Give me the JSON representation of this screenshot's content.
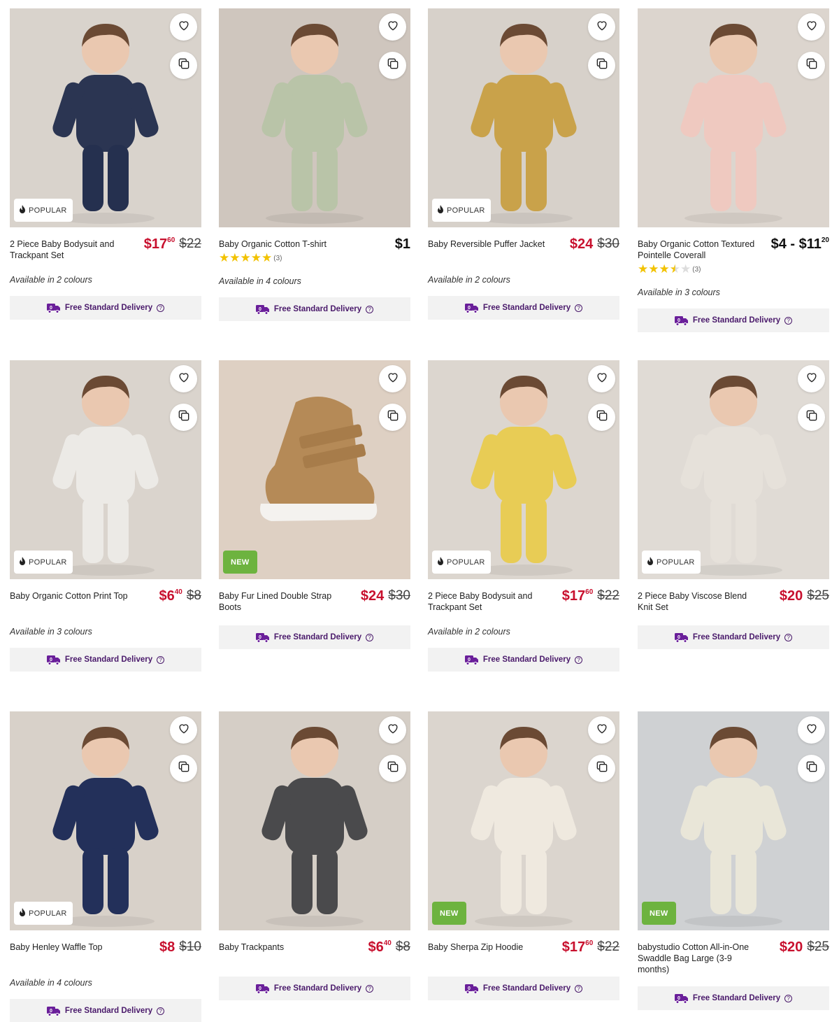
{
  "products": [
    {
      "name": "2 Piece Baby Bodysuit and Trackpant Set",
      "price_main": "$17",
      "price_cents": "60",
      "was": "$22",
      "availability": "Available in 2 colours",
      "badge": "POPULAR",
      "delivery": "Free Standard Delivery",
      "bg": "#d9d3cc"
    },
    {
      "name": "Baby Organic Cotton T-shirt",
      "price_main": "$1",
      "price_cents": "",
      "was": "",
      "rating": 5,
      "rating_count": "(3)",
      "availability": "Available in 4 colours",
      "badge": "",
      "delivery": "Free Standard Delivery",
      "bg": "#cfc6be"
    },
    {
      "name": "Baby Reversible Puffer Jacket",
      "price_main": "$24",
      "price_cents": "",
      "was": "$30",
      "availability": "Available in 2 colours",
      "badge": "POPULAR",
      "delivery": "Free Standard Delivery",
      "bg": "#d7d1ca"
    },
    {
      "name": "Baby Organic Cotton Textured Pointelle Coverall",
      "price_main": "$4 - $11",
      "price_cents": "20",
      "was": "",
      "rating": 3.5,
      "rating_count": "(3)",
      "availability": "Available in 3 colours",
      "badge": "",
      "delivery": "Free Standard Delivery",
      "bg": "#dcd5ce"
    },
    {
      "name": "Baby Organic Cotton Print Top",
      "price_main": "$6",
      "price_cents": "40",
      "was": "$8",
      "availability": "Available in 3 colours",
      "badge": "POPULAR",
      "delivery": "Free Standard Delivery",
      "bg": "#dad4cd"
    },
    {
      "name": "Baby Fur Lined Double Strap Boots",
      "price_main": "$24",
      "price_cents": "",
      "was": "$30",
      "availability": "",
      "badge": "NEW",
      "delivery": "Free Standard Delivery",
      "bg": "#ded0c3"
    },
    {
      "name": "2 Piece Baby Bodysuit and Trackpant Set",
      "price_main": "$17",
      "price_cents": "60",
      "was": "$22",
      "availability": "Available in 2 colours",
      "badge": "POPULAR",
      "delivery": "Free Standard Delivery",
      "bg": "#dcd6cf"
    },
    {
      "name": "2 Piece Baby Viscose Blend Knit Set",
      "price_main": "$20",
      "price_cents": "",
      "was": "$25",
      "availability": "",
      "badge": "POPULAR",
      "delivery": "Free Standard Delivery",
      "bg": "#e0dbd5"
    },
    {
      "name": "Baby Henley Waffle Top",
      "price_main": "$8",
      "price_cents": "",
      "was": "$10",
      "availability": "Available in 4 colours",
      "badge": "POPULAR",
      "delivery": "Free Standard Delivery",
      "bg": "#d8d1c9"
    },
    {
      "name": "Baby Trackpants",
      "price_main": "$6",
      "price_cents": "40",
      "was": "$8",
      "availability": "",
      "badge": "",
      "delivery": "Free Standard Delivery",
      "bg": "#d5cec6"
    },
    {
      "name": "Baby Sherpa Zip Hoodie",
      "price_main": "$17",
      "price_cents": "60",
      "was": "$22",
      "availability": "",
      "badge": "NEW",
      "delivery": "Free Standard Delivery",
      "bg": "#dbd5ce"
    },
    {
      "name": "babystudio Cotton All-in-One Swaddle Bag Large (3-9 months)",
      "price_main": "$20",
      "price_cents": "",
      "was": "$25",
      "availability": "",
      "badge": "NEW",
      "delivery": "Free Standard Delivery",
      "bg": "#cfd1d3"
    }
  ],
  "colors": {
    "sale": "#c8102e",
    "delivery": "#4a1a6b",
    "new_badge": "#6db33f",
    "star": "#f2c200"
  },
  "icons": {
    "wishlist": "heart-icon",
    "compare": "compare-icon",
    "popular": "flame-icon",
    "delivery": "delivery-truck-icon",
    "help": "help-icon"
  }
}
